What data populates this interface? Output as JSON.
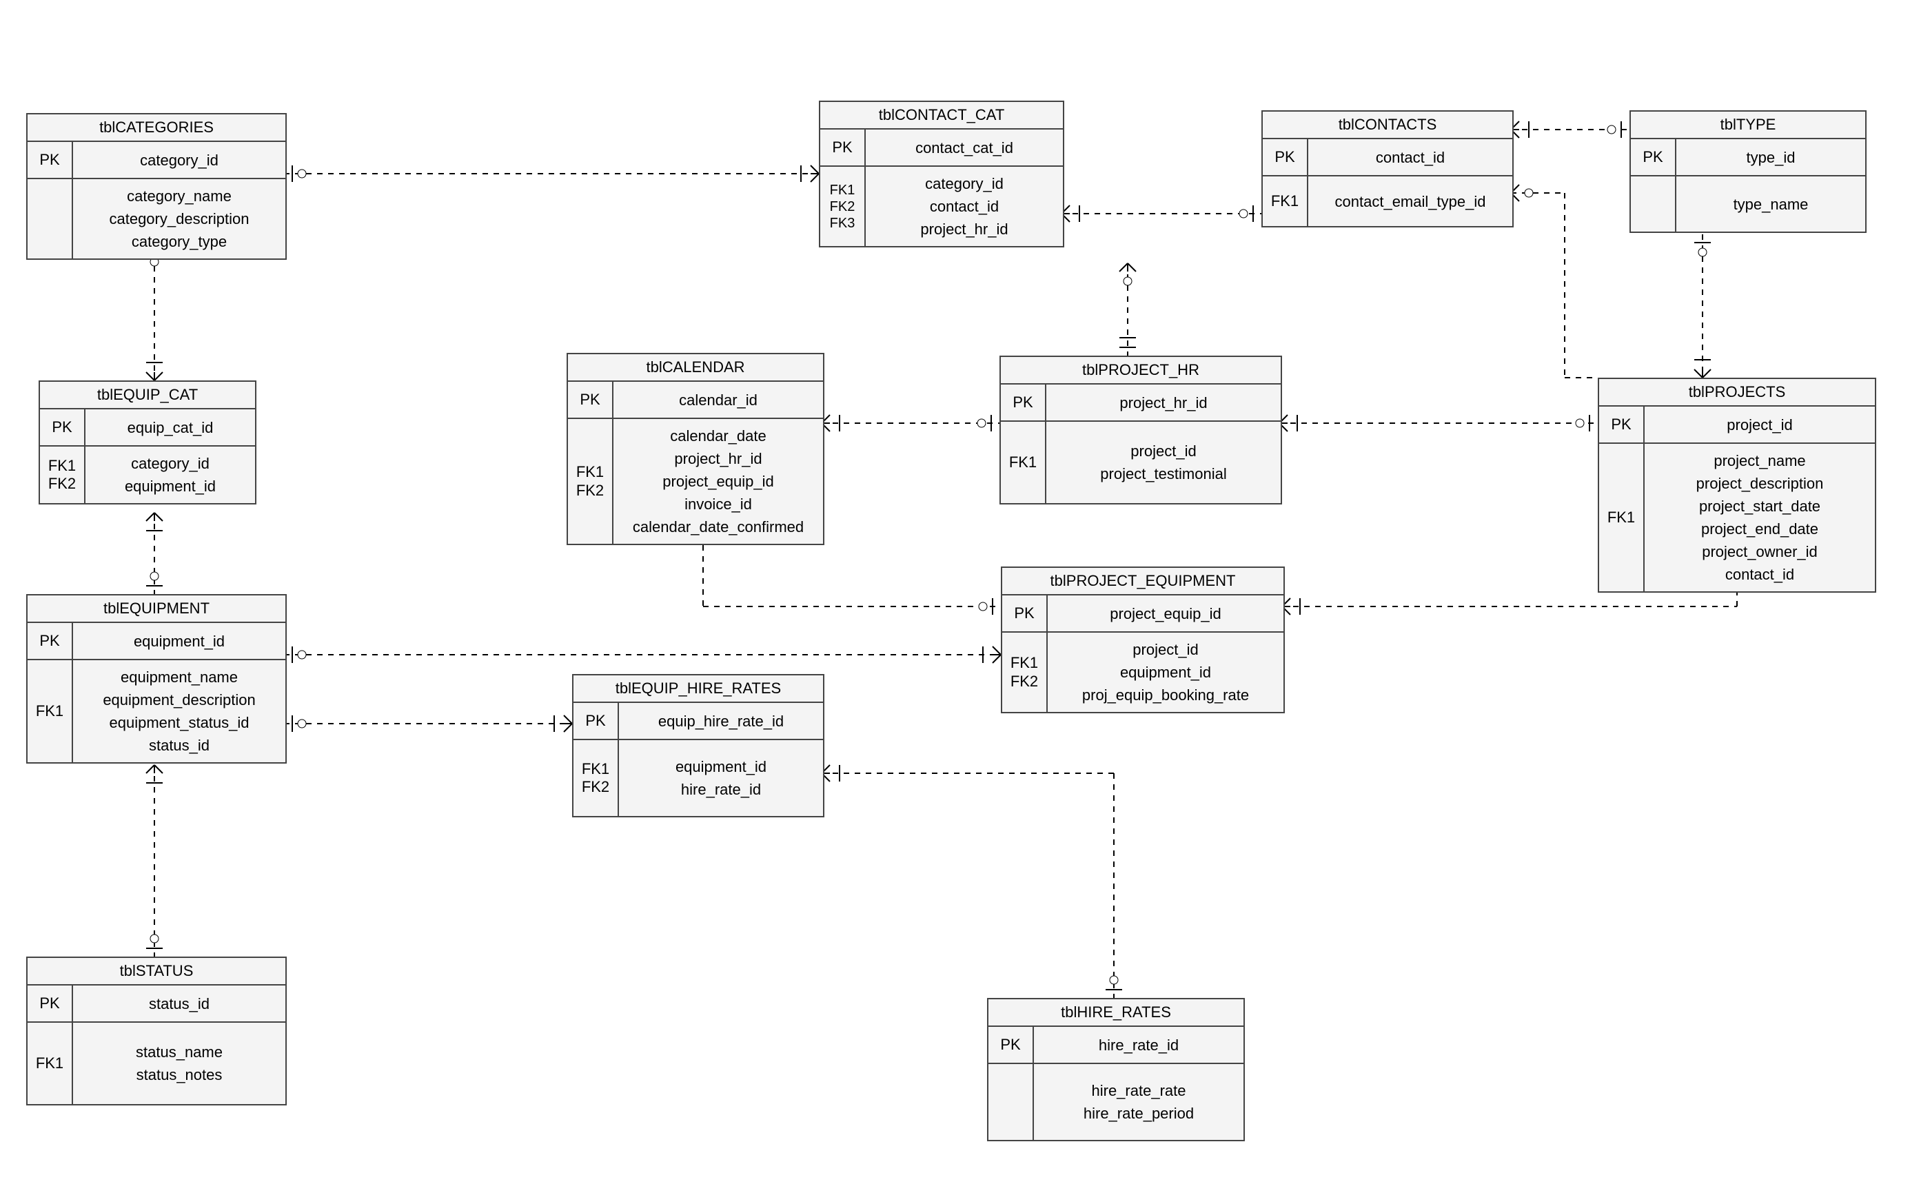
{
  "entities": {
    "tblCATEGORIES": {
      "title": "tblCATEGORIES",
      "pk": {
        "key": "PK",
        "field": "category_id"
      },
      "rows": [
        {
          "key": "",
          "fields": [
            "category_name",
            "category_description",
            "category_type"
          ]
        }
      ]
    },
    "tblEQUIP_CAT": {
      "title": "tblEQUIP_CAT",
      "pk": {
        "key": "PK",
        "field": "equip_cat_id"
      },
      "rows": [
        {
          "key": "FK1\nFK2",
          "fields": [
            "category_id",
            "equipment_id"
          ]
        }
      ]
    },
    "tblEQUIPMENT": {
      "title": "tblEQUIPMENT",
      "pk": {
        "key": "PK",
        "field": "equipment_id"
      },
      "rows": [
        {
          "key": "FK1",
          "fields": [
            "equipment_name",
            "equipment_description",
            "equipment_status_id",
            "status_id"
          ]
        }
      ]
    },
    "tblSTATUS": {
      "title": "tblSTATUS",
      "pk": {
        "key": "PK",
        "field": "status_id"
      },
      "rows": [
        {
          "key": "FK1",
          "fields": [
            "status_name",
            "status_notes"
          ]
        }
      ]
    },
    "tblCALENDAR": {
      "title": "tblCALENDAR",
      "pk": {
        "key": "PK",
        "field": "calendar_id"
      },
      "rows": [
        {
          "key": "FK1\nFK2",
          "fields": [
            "calendar_date",
            "project_hr_id",
            "project_equip_id",
            "invoice_id",
            "calendar_date_confirmed"
          ]
        }
      ]
    },
    "tblCONTACT_CAT": {
      "title": "tblCONTACT_CAT",
      "pk": {
        "key": "PK",
        "field": "contact_cat_id"
      },
      "rows": [
        {
          "key": "FK1\nFK2\nFK3",
          "fields": [
            "category_id",
            "contact_id",
            "project_hr_id"
          ]
        }
      ]
    },
    "tblPROJECT_HR": {
      "title": "tblPROJECT_HR",
      "pk": {
        "key": "PK",
        "field": "project_hr_id"
      },
      "rows": [
        {
          "key": "FK1",
          "fields": [
            "project_id",
            "project_testimonial"
          ]
        }
      ]
    },
    "tblPROJECT_EQUIPMENT": {
      "title": "tblPROJECT_EQUIPMENT",
      "pk": {
        "key": "PK",
        "field": "project_equip_id"
      },
      "rows": [
        {
          "key": "FK1\nFK2",
          "fields": [
            "project_id",
            "equipment_id",
            "proj_equip_booking_rate"
          ]
        }
      ]
    },
    "tblEQUIP_HIRE_RATES": {
      "title": "tblEQUIP_HIRE_RATES",
      "pk": {
        "key": "PK",
        "field": "equip_hire_rate_id"
      },
      "rows": [
        {
          "key": "FK1\nFK2",
          "fields": [
            "equipment_id",
            "hire_rate_id"
          ]
        }
      ]
    },
    "tblHIRE_RATES": {
      "title": "tblHIRE_RATES",
      "pk": {
        "key": "PK",
        "field": "hire_rate_id"
      },
      "rows": [
        {
          "key": "",
          "fields": [
            "hire_rate_rate",
            "hire_rate_period"
          ]
        }
      ]
    },
    "tblCONTACTS": {
      "title": "tblCONTACTS",
      "pk": {
        "key": "PK",
        "field": "contact_id"
      },
      "rows": [
        {
          "key": "FK1",
          "fields": [
            "contact_email_type_id"
          ]
        }
      ]
    },
    "tblTYPE": {
      "title": "tblTYPE",
      "pk": {
        "key": "PK",
        "field": "type_id"
      },
      "rows": [
        {
          "key": "",
          "fields": [
            "type_name"
          ]
        }
      ]
    },
    "tblPROJECTS": {
      "title": "tblPROJECTS",
      "pk": {
        "key": "PK",
        "field": "project_id"
      },
      "rows": [
        {
          "key": "FK1",
          "fields": [
            "project_name",
            "project_description",
            "project_start_date",
            "project_end_date",
            "project_owner_id",
            "contact_id"
          ]
        }
      ]
    }
  },
  "relationships": [
    {
      "from": "tblCATEGORIES.category_id",
      "to": "tblEQUIP_CAT.category_id"
    },
    {
      "from": "tblCATEGORIES.category_id",
      "to": "tblCONTACT_CAT.category_id"
    },
    {
      "from": "tblEQUIPMENT.equipment_id",
      "to": "tblEQUIP_CAT.equipment_id"
    },
    {
      "from": "tblSTATUS.status_id",
      "to": "tblEQUIPMENT.status_id"
    },
    {
      "from": "tblEQUIPMENT.equipment_id",
      "to": "tblEQUIP_HIRE_RATES.equipment_id"
    },
    {
      "from": "tblEQUIPMENT.equipment_id",
      "to": "tblPROJECT_EQUIPMENT.equipment_id"
    },
    {
      "from": "tblHIRE_RATES.hire_rate_id",
      "to": "tblEQUIP_HIRE_RATES.hire_rate_id"
    },
    {
      "from": "tblPROJECT_HR.project_hr_id",
      "to": "tblCALENDAR.project_hr_id"
    },
    {
      "from": "tblPROJECT_HR.project_hr_id",
      "to": "tblCONTACT_CAT.project_hr_id"
    },
    {
      "from": "tblPROJECT_EQUIPMENT.project_equip_id",
      "to": "tblCALENDAR.project_equip_id"
    },
    {
      "from": "tblPROJECTS.project_id",
      "to": "tblPROJECT_HR.project_id"
    },
    {
      "from": "tblPROJECTS.project_id",
      "to": "tblPROJECT_EQUIPMENT.project_id"
    },
    {
      "from": "tblCONTACTS.contact_id",
      "to": "tblCONTACT_CAT.contact_id"
    },
    {
      "from": "tblCONTACTS.contact_id",
      "to": "tblPROJECTS.contact_id"
    },
    {
      "from": "tblTYPE.type_id",
      "to": "tblCONTACTS.contact_email_type_id"
    },
    {
      "from": "tblTYPE.type_id",
      "to": "tblPROJECTS (via contact)"
    }
  ]
}
